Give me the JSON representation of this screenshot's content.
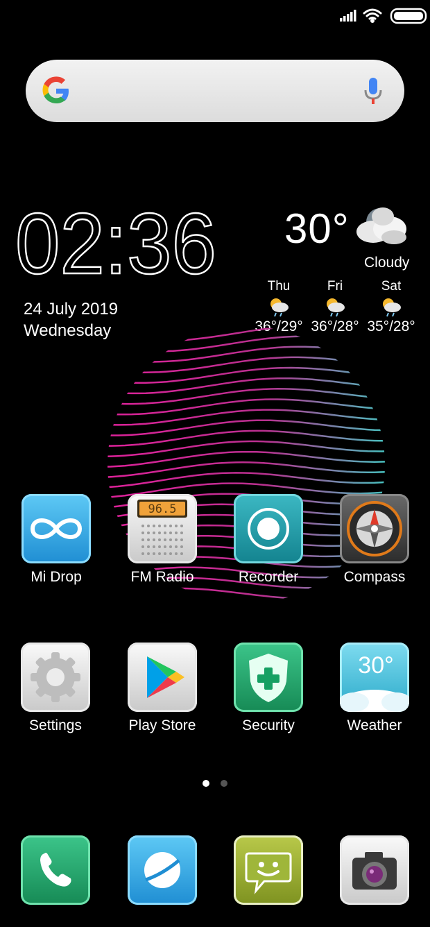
{
  "clock": {
    "time": "02:36",
    "date": "24 July 2019",
    "weekday": "Wednesday"
  },
  "weather": {
    "current_temp": "30°",
    "condition": "Cloudy",
    "forecast": [
      {
        "day": "Thu",
        "range": "36°/29°",
        "icon": "sun-cloud-rain-icon"
      },
      {
        "day": "Fri",
        "range": "36°/28°",
        "icon": "sun-cloud-rain-icon"
      },
      {
        "day": "Sat",
        "range": "35°/28°",
        "icon": "sun-cloud-rain-icon"
      }
    ]
  },
  "radio_display": "96.5",
  "weather_app_temp": "30°",
  "apps_row1": [
    {
      "label": "Mi Drop",
      "icon": "infinity-icon"
    },
    {
      "label": "FM Radio",
      "icon": "radio-icon"
    },
    {
      "label": "Recorder",
      "icon": "record-icon"
    },
    {
      "label": "Compass",
      "icon": "compass-icon"
    }
  ],
  "apps_row2": [
    {
      "label": "Settings",
      "icon": "gear-icon"
    },
    {
      "label": "Play Store",
      "icon": "play-store-icon"
    },
    {
      "label": "Security",
      "icon": "shield-plus-icon"
    },
    {
      "label": "Weather",
      "icon": "weather-icon"
    }
  ],
  "dock": [
    {
      "name": "phone",
      "icon": "phone-icon"
    },
    {
      "name": "browser",
      "icon": "browser-icon"
    },
    {
      "name": "messaging",
      "icon": "message-icon"
    },
    {
      "name": "camera",
      "icon": "camera-icon"
    }
  ],
  "page_indicator": {
    "current": 1,
    "total": 2
  },
  "colors": {
    "accent_pink": "#e0209a",
    "accent_cyan": "#38d6c6",
    "background": "#000000"
  }
}
